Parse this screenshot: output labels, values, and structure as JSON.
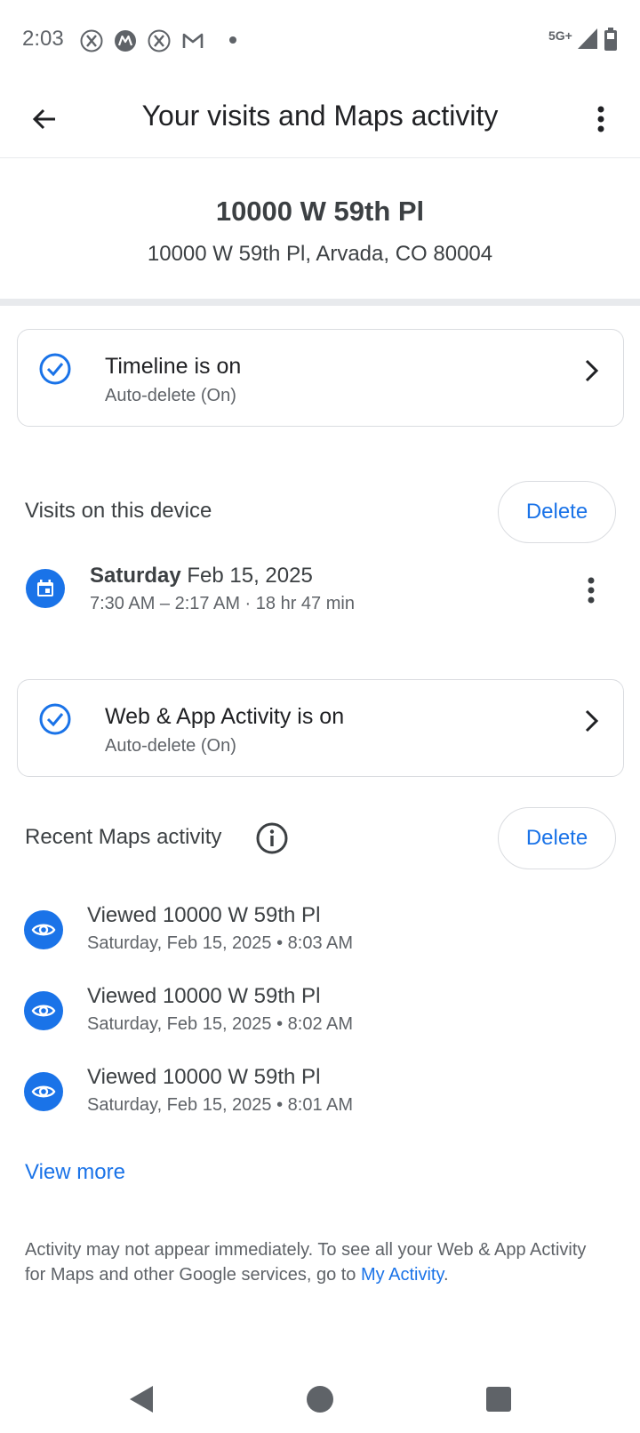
{
  "status_bar": {
    "time": "2:03",
    "network": "5G+",
    "icons": [
      "x-icon",
      "motorola-icon",
      "x-icon",
      "gmail-icon",
      "notification-dot",
      "signal-icon",
      "battery-icon"
    ]
  },
  "app_bar": {
    "title": "Your visits and Maps activity",
    "back_icon": "arrow-back-icon",
    "menu_icon": "more-vert-icon"
  },
  "place": {
    "name": "10000 W 59th Pl",
    "address": "10000 W 59th Pl, Arvada, CO 80004"
  },
  "timeline_card": {
    "title": "Timeline is on",
    "subtitle": "Auto-delete (On)"
  },
  "visits_section": {
    "title": "Visits on this device",
    "delete_label": "Delete",
    "visit": {
      "day": "Saturday",
      "date": "Feb 15, 2025",
      "time_range": "7:30 AM – 2:17 AM · 18 hr 47 min"
    }
  },
  "web_app_card": {
    "title": "Web & App Activity is on",
    "subtitle": "Auto-delete (On)"
  },
  "maps_activity": {
    "title": "Recent Maps activity",
    "delete_label": "Delete",
    "items": [
      {
        "title": "Viewed 10000 W 59th Pl",
        "subtitle": "Saturday, Feb 15, 2025 • 8:03 AM"
      },
      {
        "title": "Viewed 10000 W 59th Pl",
        "subtitle": "Saturday, Feb 15, 2025 • 8:02 AM"
      },
      {
        "title": "Viewed 10000 W 59th Pl",
        "subtitle": "Saturday, Feb 15, 2025 • 8:01 AM"
      }
    ],
    "view_more_label": "View more"
  },
  "footer": {
    "text": "Activity may not appear immediately. To see all your Web & App Activity for Maps and other Google services, go to ",
    "link_label": "My Activity",
    "end": "."
  },
  "colors": {
    "accent": "#1a73e8",
    "text_primary": "#202124",
    "text_secondary": "#5f6368",
    "border": "#dadce0"
  }
}
